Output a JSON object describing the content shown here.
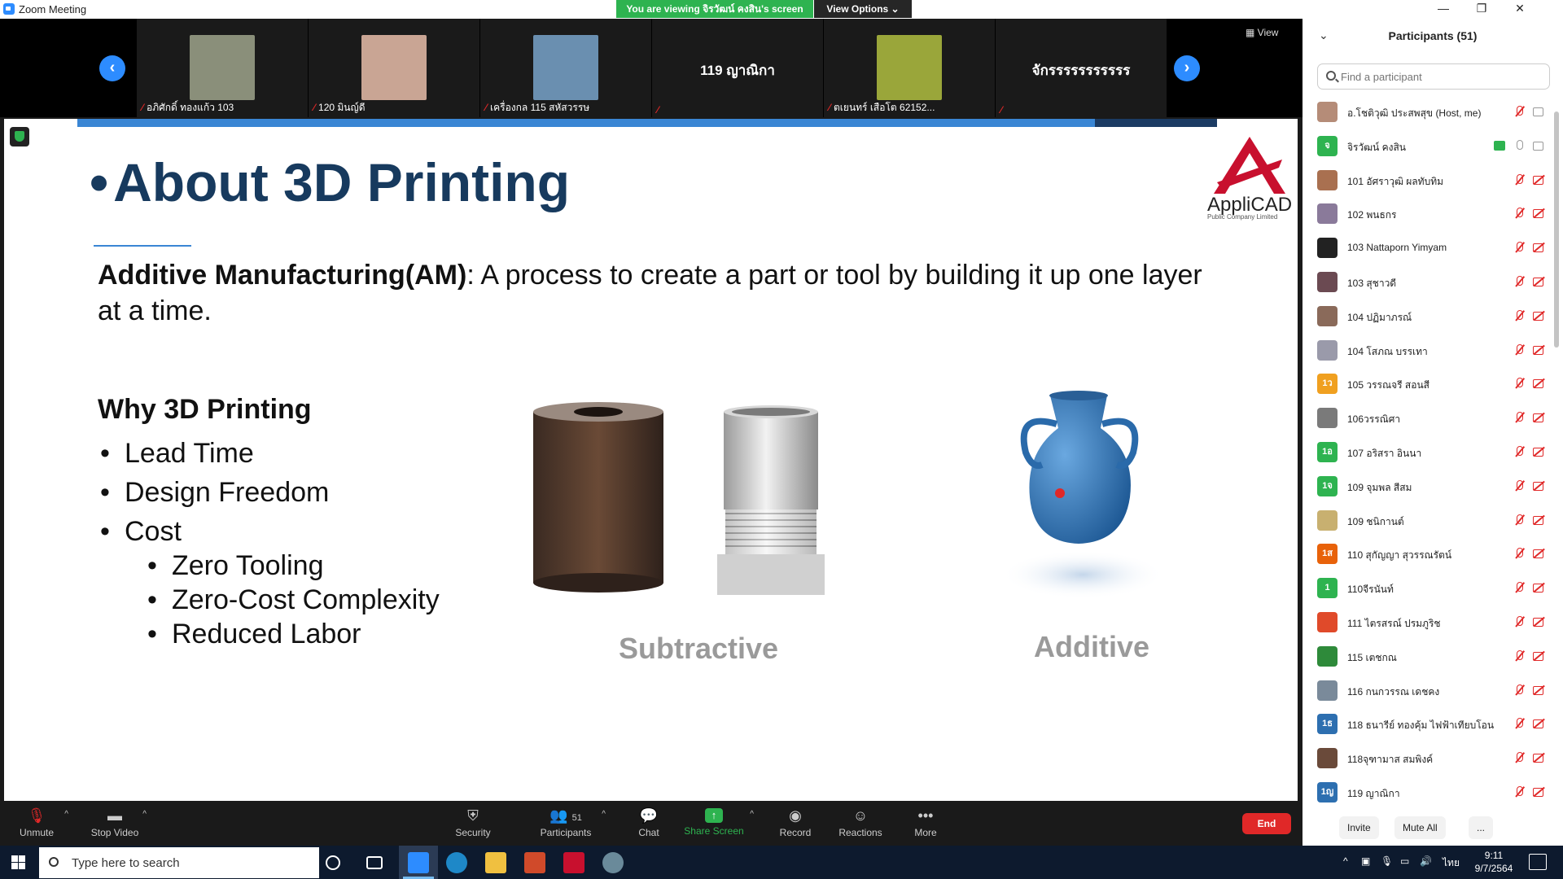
{
  "window": {
    "title": "Zoom Meeting",
    "viewing_banner": "You are viewing จิรวัฒน์ คงสิน's screen",
    "view_options": "View Options ⌄",
    "controls": [
      "—",
      "❐",
      "✕"
    ]
  },
  "video_strip": {
    "view_label": "View",
    "tiles": [
      {
        "name": "อภิศักดิ์ ทองแก้ว 103",
        "kind": "photo",
        "color": "#8a8f7a"
      },
      {
        "name": "120 มินญ์ดี",
        "kind": "photo",
        "color": "#c9a594"
      },
      {
        "name": "เครื่องกล 115 สหัสวรรษ",
        "kind": "photo",
        "color": "#6a8fb0"
      },
      {
        "name": "",
        "kind": "name",
        "big_name": "119 ญาณิกา"
      },
      {
        "name": "ตเยนทร์ เสือโต 62152...",
        "kind": "photo",
        "color": "#9aa63a"
      },
      {
        "name": "",
        "kind": "name",
        "big_name": "จักรรรรรรรรรรร"
      }
    ]
  },
  "slide": {
    "title": "About 3D Printing",
    "definition_bold": "Additive Manufacturing(AM)",
    "definition_rest": ": A process to create a part or tool by building it up one layer at a time.",
    "why_heading": "Why 3D Printing",
    "bullets": [
      "Lead Time",
      "Design Freedom",
      "Cost"
    ],
    "sub_bullets": [
      "Zero Tooling",
      "Zero-Cost Complexity",
      "Reduced Labor"
    ],
    "label_subtractive": "Subtractive",
    "label_additive": "Additive",
    "logo_word": "AppliCAD",
    "logo_sub": "Public Company Limited",
    "brand_color": "#c8102e",
    "title_color": "#173a5e"
  },
  "participants": {
    "title": "Participants (51)",
    "search_placeholder": "Find a participant",
    "list": [
      {
        "name": "อ.โชติวุฒิ ประสพสุข (Host, me)",
        "avatar": "photo",
        "color": "#b58c78",
        "mic": "off",
        "video": "on"
      },
      {
        "name": "จิรวัฒน์ คงสิน",
        "avatar": "จ",
        "color": "#2eb350",
        "mic": "on",
        "video": "on",
        "sharing": true
      },
      {
        "name": "101 อัศราวุฒิ ผลทับทิม",
        "avatar": "photo",
        "color": "#a97050",
        "mic": "off",
        "video": "off"
      },
      {
        "name": "102 พนธกร",
        "avatar": "photo",
        "color": "#8a7a9a",
        "mic": "off",
        "video": "off"
      },
      {
        "name": "103 Nattaporn Yimyam",
        "avatar": "photo",
        "color": "#222222",
        "mic": "off",
        "video": "off"
      },
      {
        "name": "103 สุชาวดี",
        "avatar": "photo",
        "color": "#6b4a52",
        "mic": "off",
        "video": "off"
      },
      {
        "name": "104 ปฏิมาภรณ์",
        "avatar": "photo",
        "color": "#8a6a5a",
        "mic": "off",
        "video": "off"
      },
      {
        "name": "104 โสภณ บรรเทา",
        "avatar": "photo",
        "color": "#9a9aaa",
        "mic": "off",
        "video": "off"
      },
      {
        "name": "105 วรรณจรี สอนสี",
        "avatar": "1ว",
        "color": "#f0a020",
        "mic": "off",
        "video": "off"
      },
      {
        "name": "106วรรณิศา",
        "avatar": "photo",
        "color": "#7a7a7a",
        "mic": "off",
        "video": "off"
      },
      {
        "name": "107 อริสรา อินนา",
        "avatar": "1อ",
        "color": "#2eb350",
        "mic": "off",
        "video": "off"
      },
      {
        "name": "109 จุมพล สีสม",
        "avatar": "1จ",
        "color": "#2eb350",
        "mic": "off",
        "video": "off"
      },
      {
        "name": "109 ชนิกานต์",
        "avatar": "photo",
        "color": "#c8b070",
        "mic": "off",
        "video": "off"
      },
      {
        "name": "110 สุกัญญา สุวรรณรัตน์",
        "avatar": "1ส",
        "color": "#e8620a",
        "mic": "off",
        "video": "off"
      },
      {
        "name": "110จีรนันท์",
        "avatar": "1",
        "color": "#2eb350",
        "mic": "off",
        "video": "off"
      },
      {
        "name": "111 ไตรสรณ์ ปรมภูริช",
        "avatar": "photo",
        "color": "#e04a2a",
        "mic": "off",
        "video": "off"
      },
      {
        "name": "115 เตชกณ",
        "avatar": "photo",
        "color": "#2e8a3a",
        "mic": "off",
        "video": "off"
      },
      {
        "name": "116 กนกวรรณ เดชคง",
        "avatar": "photo",
        "color": "#7a8a9a",
        "mic": "off",
        "video": "off"
      },
      {
        "name": "118 ธนารีย์ ทองคุ้ม ไฟฟ้าเทียบโอน",
        "avatar": "1ธ",
        "color": "#2d6fb0",
        "mic": "off",
        "video": "off"
      },
      {
        "name": "118จุฑามาส สมพิงค์",
        "avatar": "photo",
        "color": "#6a4a3a",
        "mic": "off",
        "video": "off"
      },
      {
        "name": "119 ญาณิกา",
        "avatar": "1ญ",
        "color": "#2d6fb0",
        "mic": "off",
        "video": "off"
      }
    ],
    "invite": "Invite",
    "mute_all": "Mute All",
    "more": "..."
  },
  "toolbar": {
    "unmute": "Unmute",
    "stop_video": "Stop Video",
    "security": "Security",
    "participants": "Participants",
    "participants_count": "51",
    "chat": "Chat",
    "share_screen": "Share Screen",
    "record": "Record",
    "reactions": "Reactions",
    "more": "More",
    "end": "End"
  },
  "taskbar": {
    "search_placeholder": "Type here to search",
    "time": "9:11",
    "date": "9/7/2564",
    "lang": "ไทย"
  }
}
